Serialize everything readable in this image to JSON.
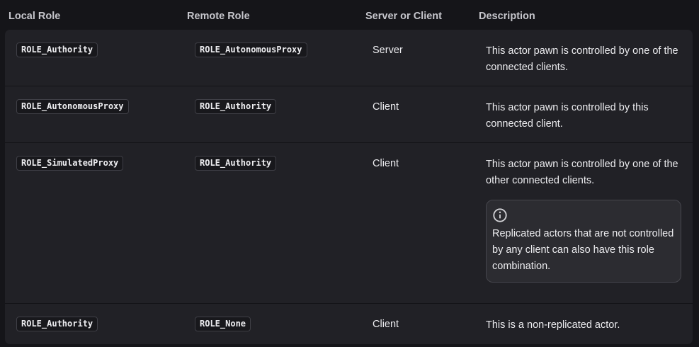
{
  "headers": {
    "local_role": "Local Role",
    "remote_role": "Remote Role",
    "server_or_client": "Server or Client",
    "description": "Description"
  },
  "rows": [
    {
      "local_role": "ROLE_Authority",
      "remote_role": "ROLE_AutonomousProxy",
      "server_or_client": "Server",
      "description": "This actor pawn is controlled by one of the connected clients."
    },
    {
      "local_role": "ROLE_AutonomousProxy",
      "remote_role": "ROLE_Authority",
      "server_or_client": "Client",
      "description": "This actor pawn is controlled by this connected client."
    },
    {
      "local_role": "ROLE_SimulatedProxy",
      "remote_role": "ROLE_Authority",
      "server_or_client": "Client",
      "description": "This actor pawn is controlled by one of the other connected clients.",
      "note": {
        "icon": "info-icon",
        "text": "Replicated actors that are not controlled by any client can also have this role combination."
      }
    },
    {
      "local_role": "ROLE_Authority",
      "remote_role": "ROLE_None",
      "server_or_client": "Client",
      "description": "This is a non-replicated actor."
    }
  ],
  "colors": {
    "page_background": "#151519",
    "table_background": "#212126",
    "note_background": "#2c2c31",
    "text": "#ececef",
    "header_text": "#c6c6cc"
  }
}
